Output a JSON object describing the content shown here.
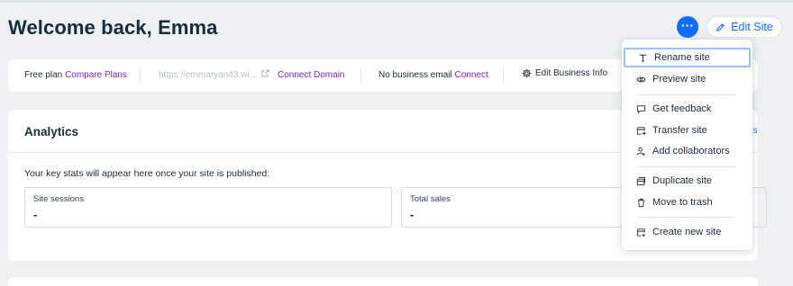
{
  "header": {
    "welcome": "Welcome back, Emma",
    "more_label": "···",
    "edit_site_label": "Edit Site"
  },
  "infobar": {
    "plan_text": "Free plan",
    "compare_plans": "Compare Plans",
    "site_url": "https://emmaryan43.wi...",
    "connect_domain": "Connect Domain",
    "business_email_text": "No business email",
    "connect": "Connect",
    "edit_business_info": "Edit Business Info"
  },
  "analytics": {
    "title": "Analytics",
    "reports_link": "orts",
    "note": "Your key stats will appear here once your site is published:",
    "stats": [
      {
        "label": "Site sessions",
        "value": "-"
      },
      {
        "label": "Total sales",
        "value": "-"
      }
    ]
  },
  "menu": {
    "items": [
      {
        "label": "Rename site",
        "icon": "text-icon"
      },
      {
        "label": "Preview site",
        "icon": "eye-icon"
      },
      {
        "label": "Get feedback",
        "icon": "chat-icon"
      },
      {
        "label": "Transfer site",
        "icon": "transfer-icon"
      },
      {
        "label": "Add collaborators",
        "icon": "add-user-icon"
      },
      {
        "label": "Duplicate site",
        "icon": "duplicate-icon"
      },
      {
        "label": "Move to trash",
        "icon": "trash-icon"
      },
      {
        "label": "Create new site",
        "icon": "create-site-icon"
      }
    ]
  },
  "colors": {
    "accent_blue": "#116dff",
    "link_purple": "#7b1ed6",
    "background": "#eef0f4"
  }
}
